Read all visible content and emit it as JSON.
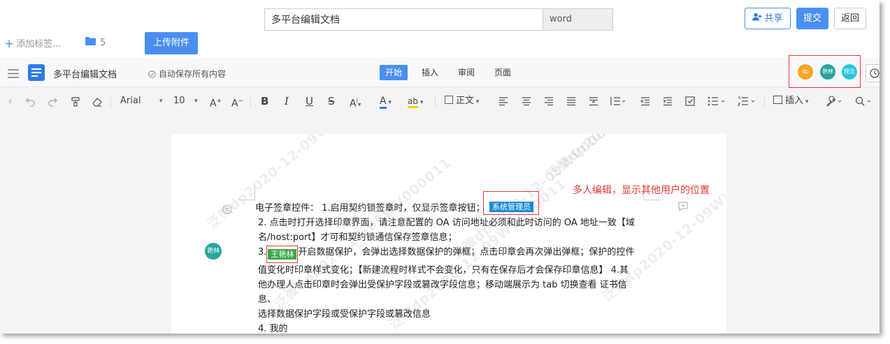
{
  "header": {
    "doc_title_value": "多平台编辑文档",
    "doc_type": "word",
    "share_label": "共享",
    "submit_label": "提交",
    "back_label": "返回"
  },
  "subbar": {
    "add_tag_label": "添加标签...",
    "folder_count": "5",
    "upload_label": "上传附件"
  },
  "editor": {
    "doc_title": "多平台编辑文档",
    "autosave_label": "自动保存所有内容",
    "tabs": [
      {
        "label": "开始",
        "active": true
      },
      {
        "label": "插入",
        "active": false
      },
      {
        "label": "审阅",
        "active": false
      },
      {
        "label": "页面",
        "active": false
      }
    ],
    "collaborators": [
      {
        "label": "dp",
        "color": "#f5a623"
      },
      {
        "label": "艳林",
        "color": "#26a69a"
      },
      {
        "label": "理员",
        "color": "#26c6da"
      }
    ]
  },
  "toolbar": {
    "font_family": "Arial",
    "font_size": "10",
    "paragraph_style": "正文",
    "insert_label": "插入"
  },
  "document": {
    "watermark": "泛微dp2020-12-09WV000011",
    "annotation": "多人编辑，显示其他用户的位置",
    "side_user": "艳林",
    "cursor_admin": "系统管理员",
    "cursor_wang": "王艳林",
    "line1": "电子签章控件： 1.启用契约锁签章时，仅显示签章按钮；",
    "line2": "2. 点击时打开选择印章界面，请注意配置的 OA 访问地址必须和此时访问的 OA 地址一致【域",
    "line3": "名/host:port】才可和契约锁通信保存签章信息；",
    "line4_prefix": "3.",
    "line4_rest": "开启数据保护，会弹出选择数据保护的弹框；点击印章会再次弹出弹框；保护的控件",
    "line5": "值变化时印章样式变化；【新建流程时样式不会变化，只有在保存后才会保存印章信息】 4.其",
    "line6": "他办理人点击印章时会弹出受保护字段或篡改字段信息；移动端展示为 tab 切换查看 证书信息、",
    "line7": "选择数据保护字段或受保护字段或篡改信息",
    "line8": "4. 我的"
  }
}
